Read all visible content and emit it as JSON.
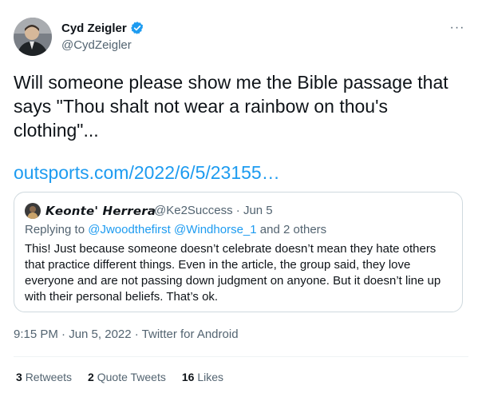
{
  "author": {
    "name": "Cyd Zeigler",
    "handle": "@CydZeigler"
  },
  "more_label": "···",
  "tweet": {
    "text": "Will someone please show me the Bible passage that says \"Thou shalt not wear a rainbow on thou's clothing\"...",
    "link": "outsports.com/2022/6/5/23155…"
  },
  "quote": {
    "name": "𝙆𝙚𝙤𝙣𝙩𝙚' 𝙃𝙚𝙧𝙧𝙚𝙧𝙖",
    "handle": "@Ke2Success",
    "date": "Jun 5",
    "reply_prefix": "Replying to ",
    "reply_users": "@Jwoodthefirst @Windhorse_1",
    "reply_suffix": " and 2 others",
    "text": "This! Just because someone doesn’t celebrate doesn’t mean they hate others that practice different things. Even in the article, the group said, they love everyone and are not passing down judgment on anyone. But it doesn’t line up with their personal beliefs. That’s ok."
  },
  "timestamp": "9:15 PM · Jun 5, 2022 · Twitter for Android",
  "stats": {
    "retweets_count": "3",
    "retweets_label": "Retweets",
    "quotes_count": "2",
    "quotes_label": "Quote Tweets",
    "likes_count": "16",
    "likes_label": "Likes"
  },
  "colors": {
    "accent": "#1d9bf0",
    "secondary_text": "#536471",
    "border": "#cfd9de"
  }
}
